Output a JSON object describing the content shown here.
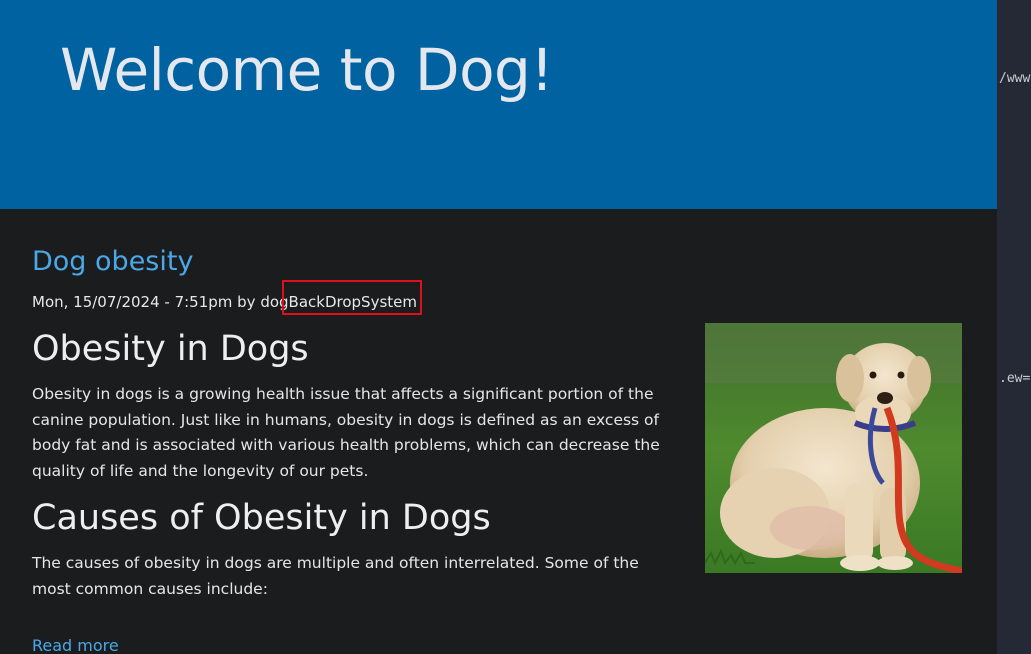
{
  "header": {
    "site_title": "Welcome to Dog!"
  },
  "article": {
    "title": "Dog obesity",
    "submitted_prefix": "Mon, 15/07/2024 - 7:51pm by dog",
    "author": "BackDropSystem",
    "heading_1": "Obesity in Dogs",
    "paragraph_1": "Obesity in dogs is a growing health issue that affects a significant portion of the canine population. Just like in humans, obesity in dogs is defined as an excess of body fat and is associated with various health problems, which can decrease the quality of life and the longevity of our pets.",
    "heading_2": "Causes of Obesity in Dogs",
    "paragraph_2": "The causes of obesity in dogs are multiple and often interrelated. Some of the most common causes include:",
    "read_more": "Read more"
  },
  "terminal": {
    "line_1": "/www",
    "line_2": ".ew="
  },
  "colors": {
    "header_bg": "#0062a0",
    "page_bg": "#1b1c1e",
    "link": "#4aa8e8",
    "highlight": "#e0101a",
    "terminal_bg": "#252935"
  }
}
